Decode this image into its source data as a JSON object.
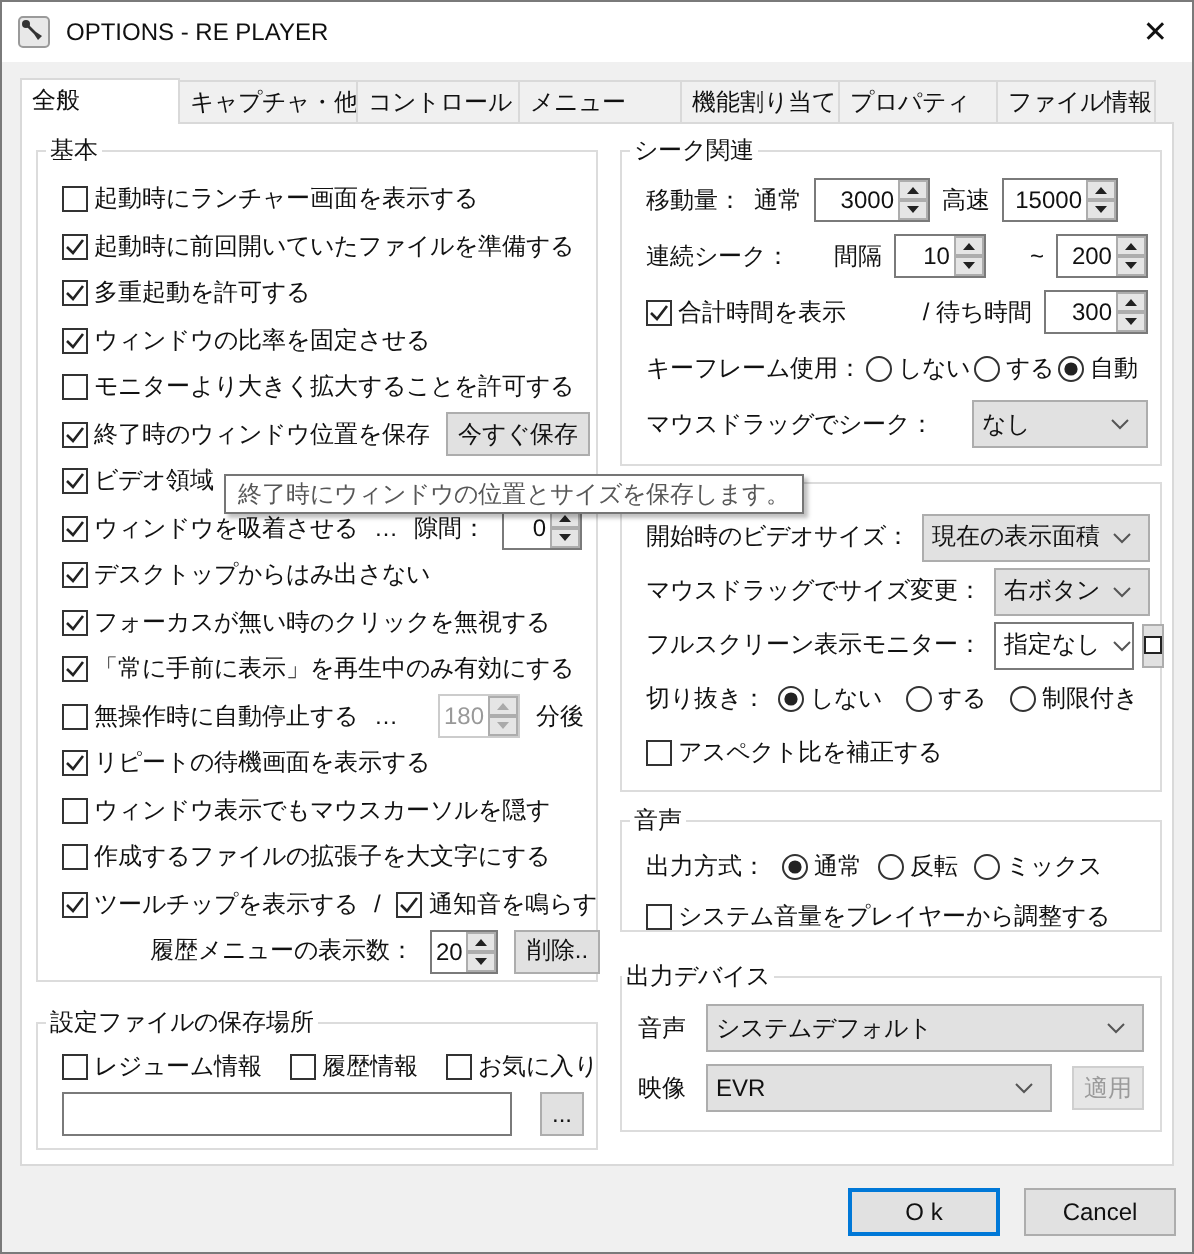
{
  "window": {
    "title": "OPTIONS - RE PLAYER",
    "close": "✕"
  },
  "tabs": [
    {
      "label": "全般",
      "selected": true
    },
    {
      "label": "キャプチャ・他",
      "selected": false
    },
    {
      "label": "コントロール",
      "selected": false
    },
    {
      "label": "メニュー",
      "selected": false
    },
    {
      "label": "機能割り当て",
      "selected": false
    },
    {
      "label": "プロパティ",
      "selected": false
    },
    {
      "label": "ファイル情報",
      "selected": false
    }
  ],
  "left_groups": [
    {
      "title": "基本",
      "rows": [
        {
          "items": [
            {
              "kind": "check",
              "label": "起動時にランチャー画面を表示する",
              "checked": false
            }
          ]
        },
        {
          "items": [
            {
              "kind": "check",
              "label": "起動時に前回開いていたファイルを準備する",
              "checked": true
            }
          ]
        },
        {
          "items": [
            {
              "kind": "check",
              "label": "多重起動を許可する",
              "checked": true
            }
          ]
        },
        {
          "items": [
            {
              "kind": "check",
              "label": "ウィンドウの比率を固定させる",
              "checked": true
            }
          ]
        },
        {
          "items": [
            {
              "kind": "check",
              "label": "モニターより大きく拡大することを許可する",
              "checked": false
            }
          ]
        },
        {
          "items": [
            {
              "kind": "check",
              "label": "終了時のウィンドウ位置を保存",
              "checked": true
            },
            {
              "kind": "button",
              "label": "今すぐ保存",
              "disabled": false
            }
          ]
        },
        {
          "items": [
            {
              "kind": "check",
              "label": "ビデオ領域",
              "checked": true
            }
          ]
        },
        {
          "items": [
            {
              "kind": "check",
              "label": "ウィンドウを吸着させる",
              "checked": true
            },
            {
              "kind": "text",
              "label": "…"
            },
            {
              "kind": "text",
              "label": "隙間："
            },
            {
              "kind": "spin",
              "value": "0",
              "disabled": false
            }
          ]
        },
        {
          "items": [
            {
              "kind": "check",
              "label": "デスクトップからはみ出さない",
              "checked": true
            }
          ]
        },
        {
          "items": [
            {
              "kind": "check",
              "label": "フォーカスが無い時のクリックを無視する",
              "checked": true
            }
          ]
        },
        {
          "items": [
            {
              "kind": "check",
              "label": "「常に手前に表示」を再生中のみ有効にする",
              "checked": true
            }
          ]
        },
        {
          "items": [
            {
              "kind": "check",
              "label": "無操作時に自動停止する",
              "checked": false
            },
            {
              "kind": "text",
              "label": "…"
            },
            {
              "kind": "spin",
              "value": "180",
              "disabled": true
            },
            {
              "kind": "text",
              "label": "分後"
            }
          ]
        },
        {
          "items": [
            {
              "kind": "check",
              "label": "リピートの待機画面を表示する",
              "checked": true
            }
          ]
        },
        {
          "items": [
            {
              "kind": "check",
              "label": "ウィンドウ表示でもマウスカーソルを隠す",
              "checked": false
            }
          ]
        },
        {
          "items": [
            {
              "kind": "check",
              "label": "作成するファイルの拡張子を大文字にする",
              "checked": false
            }
          ]
        },
        {
          "items": [
            {
              "kind": "check",
              "label": "ツールチップを表示する",
              "checked": true
            },
            {
              "kind": "text",
              "label": "/"
            },
            {
              "kind": "check",
              "label": "通知音を鳴らす",
              "checked": true
            }
          ]
        },
        {
          "items": [
            {
              "kind": "text",
              "label": "履歴メニューの表示数："
            },
            {
              "kind": "spin",
              "value": "20",
              "disabled": false
            },
            {
              "kind": "button",
              "label": "削除..",
              "disabled": false
            }
          ]
        }
      ]
    },
    {
      "title": "設定ファイルの保存場所",
      "rows": [
        {
          "items": [
            {
              "kind": "check",
              "label": "レジューム情報",
              "checked": false
            },
            {
              "kind": "check",
              "label": "履歴情報",
              "checked": false
            },
            {
              "kind": "check",
              "label": "お気に入り",
              "checked": false
            }
          ]
        },
        {
          "items": [
            {
              "kind": "field"
            },
            {
              "kind": "button",
              "label": "...",
              "disabled": false
            }
          ]
        }
      ]
    }
  ],
  "right_groups": [
    {
      "title": "シーク関連",
      "rows": [
        {
          "items": [
            {
              "kind": "text",
              "label": "移動量："
            },
            {
              "kind": "text",
              "label": "通常"
            },
            {
              "kind": "spin",
              "value": "3000",
              "disabled": false
            },
            {
              "kind": "text",
              "label": "高速"
            },
            {
              "kind": "spin",
              "value": "15000",
              "disabled": false
            }
          ]
        },
        {
          "items": [
            {
              "kind": "text",
              "label": "連続シーク："
            },
            {
              "kind": "text",
              "label": "間隔"
            },
            {
              "kind": "spin",
              "value": "10",
              "disabled": false
            },
            {
              "kind": "text",
              "label": "~"
            },
            {
              "kind": "spin",
              "value": "200",
              "disabled": false
            }
          ]
        },
        {
          "items": [
            {
              "kind": "check",
              "label": "合計時間を表示",
              "checked": true
            },
            {
              "kind": "text",
              "label": "/ 待ち時間"
            },
            {
              "kind": "spin",
              "value": "300",
              "disabled": false
            }
          ]
        },
        {
          "items": [
            {
              "kind": "text",
              "label": "キーフレーム使用："
            },
            {
              "kind": "radio",
              "label": "しない",
              "selected": false
            },
            {
              "kind": "radio",
              "label": "する",
              "selected": false
            },
            {
              "kind": "radio",
              "label": "自動",
              "selected": true
            }
          ]
        },
        {
          "items": [
            {
              "kind": "text",
              "label": "マウスドラッグでシーク："
            },
            {
              "kind": "select",
              "value": "なし"
            }
          ]
        }
      ]
    },
    {
      "rows": [
        {
          "items": [
            {
              "kind": "text",
              "label": "開始時のビデオサイズ："
            },
            {
              "kind": "select",
              "value": "現在の表示面積"
            }
          ]
        },
        {
          "items": [
            {
              "kind": "text",
              "label": "マウスドラッグでサイズ変更："
            },
            {
              "kind": "select",
              "value": "右ボタン"
            }
          ]
        },
        {
          "items": [
            {
              "kind": "text",
              "label": "フルスクリーン表示モニター："
            },
            {
              "kind": "combo",
              "value": "指定なし"
            },
            {
              "kind": "icon_button"
            }
          ]
        },
        {
          "items": [
            {
              "kind": "text",
              "label": "切り抜き："
            },
            {
              "kind": "radio",
              "label": "しない",
              "selected": true
            },
            {
              "kind": "radio",
              "label": "する",
              "selected": false
            },
            {
              "kind": "radio",
              "label": "制限付き",
              "selected": false
            }
          ]
        },
        {
          "items": [
            {
              "kind": "check",
              "label": "アスペクト比を補正する",
              "checked": false
            }
          ]
        }
      ]
    },
    {
      "title": "音声",
      "rows": [
        {
          "items": [
            {
              "kind": "text",
              "label": "出力方式："
            },
            {
              "kind": "radio",
              "label": "通常",
              "selected": true
            },
            {
              "kind": "radio",
              "label": "反転",
              "selected": false
            },
            {
              "kind": "radio",
              "label": "ミックス",
              "selected": false
            }
          ]
        },
        {
          "items": [
            {
              "kind": "check",
              "label": "システム音量をプレイヤーから調整する",
              "checked": false
            }
          ]
        }
      ]
    },
    {
      "title": "出力デバイス",
      "rows": [
        {
          "items": [
            {
              "kind": "text",
              "label": "音声"
            },
            {
              "kind": "select",
              "value": "システムデフォルト"
            }
          ]
        },
        {
          "items": [
            {
              "kind": "text",
              "label": "映像"
            },
            {
              "kind": "select",
              "value": "EVR"
            },
            {
              "kind": "button",
              "label": "適用",
              "disabled": true
            }
          ]
        }
      ]
    }
  ],
  "tooltip": {
    "text": "終了時にウィンドウの位置とサイズを保存します。"
  },
  "buttons": [
    {
      "label": "O k",
      "default": true
    },
    {
      "label": "Cancel",
      "default": false
    }
  ]
}
